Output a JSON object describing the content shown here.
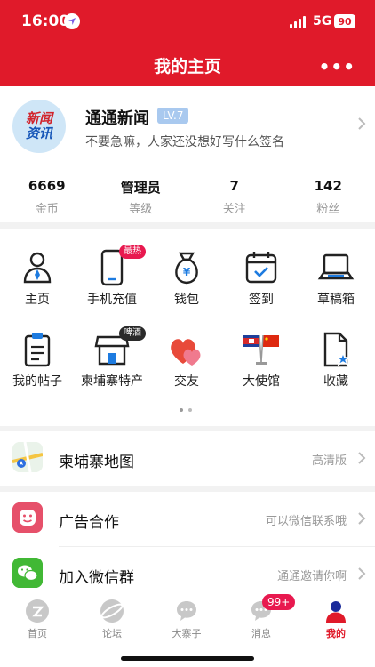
{
  "status": {
    "time": "16:00",
    "network": "5G",
    "battery": "90"
  },
  "header": {
    "title": "我的主页",
    "more": "•••"
  },
  "profile": {
    "avatar_line1": "新闻",
    "avatar_line2": "资讯",
    "name": "通通新闻",
    "level": "LV.7",
    "signature": "不要急嘛，人家还没想好写什么签名",
    "stats": [
      {
        "value": "6669",
        "label": "金币"
      },
      {
        "value": "管理员",
        "label": "等级"
      },
      {
        "value": "7",
        "label": "关注"
      },
      {
        "value": "142",
        "label": "粉丝"
      }
    ]
  },
  "grid": [
    {
      "label": "主页",
      "icon": "user-icon"
    },
    {
      "label": "手机充值",
      "icon": "phone-icon",
      "badge": "最热"
    },
    {
      "label": "钱包",
      "icon": "wallet-icon"
    },
    {
      "label": "签到",
      "icon": "calendar-check-icon"
    },
    {
      "label": "草稿箱",
      "icon": "laptop-icon"
    },
    {
      "label": "我的帖子",
      "icon": "clipboard-icon"
    },
    {
      "label": "柬埔寨特产",
      "icon": "store-icon",
      "badge": "啤酒"
    },
    {
      "label": "交友",
      "icon": "hearts-icon"
    },
    {
      "label": "大使馆",
      "icon": "flags-icon"
    },
    {
      "label": "收藏",
      "icon": "star-file-icon"
    }
  ],
  "rows": [
    {
      "title": "柬埔寨地图",
      "sub": "高清版"
    },
    {
      "title": "广告合作",
      "sub": "可以微信联系哦"
    },
    {
      "title": "加入微信群",
      "sub": "通通邀请你啊"
    }
  ],
  "tabs": [
    {
      "label": "首页"
    },
    {
      "label": "论坛"
    },
    {
      "label": "大寨子"
    },
    {
      "label": "消息",
      "badge": "99+"
    },
    {
      "label": "我的"
    }
  ],
  "colors": {
    "brand": "#e01a2a",
    "badge_hot": "#e8194f",
    "badge_beer": "#2a2a2a",
    "level": "#a9c9ef"
  }
}
